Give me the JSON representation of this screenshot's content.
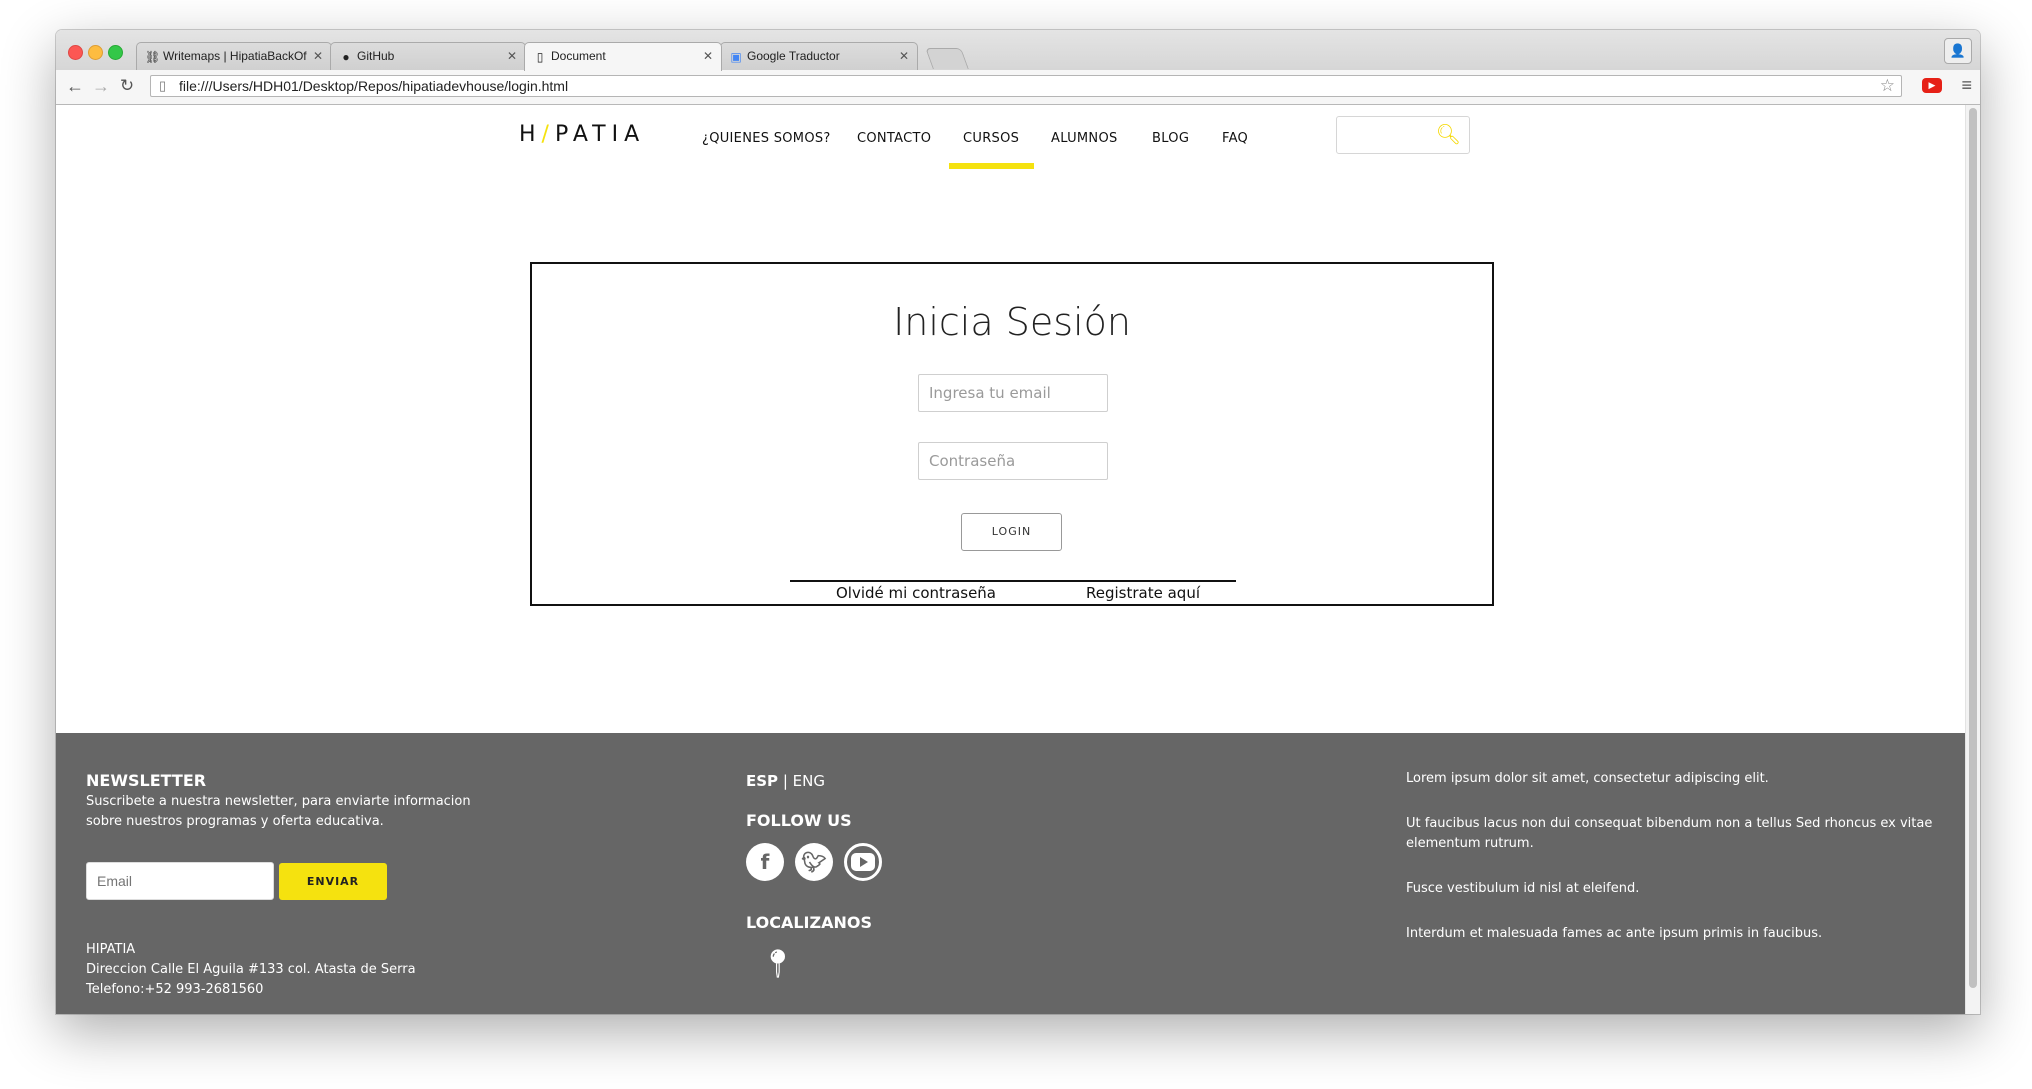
{
  "browser": {
    "tabs": [
      {
        "title": "Writemaps | HipatiaBackOf",
        "icon": "sitemap-icon"
      },
      {
        "title": "GitHub",
        "icon": "github-icon"
      },
      {
        "title": "Document",
        "icon": "document-icon"
      },
      {
        "title": "Google Traductor",
        "icon": "translate-icon"
      }
    ],
    "url": "file:///Users/HDH01/Desktop/Repos/hipatiadevhouse/login.html"
  },
  "site": {
    "logo": "H/PATIA",
    "nav": [
      "¿QUIENES SOMOS?",
      "CONTACTO",
      "CURSOS",
      "ALUMNOS",
      "BLOG",
      "FAQ"
    ],
    "active_nav": "CURSOS",
    "accent_color": "#f5e20f"
  },
  "login": {
    "title": "Inicia Sesión",
    "email_placeholder": "Ingresa tu email",
    "password_placeholder": "Contraseña",
    "button": "LOGIN",
    "forgot_link": "Olvidé mi contraseña",
    "register_link": "Registrate aquí"
  },
  "footer": {
    "newsletter_title": "NEWSLETTER",
    "newsletter_text_1": "Suscribete a nuestra newsletter, para enviarte informacion",
    "newsletter_text_2": "sobre nuestros programas y oferta educativa.",
    "email_placeholder": "Email",
    "send_button": "ENVIAR",
    "company": "HIPATIA",
    "address": "Direccion Calle El Aguila #133 col. Atasta de Serra",
    "phone": "Telefono:+52 993-2681560",
    "lang_esp": "ESP",
    "lang_sep": "|",
    "lang_eng": "ENG",
    "follow_title": "FOLLOW US",
    "locate_title": "LOCALIZANOS",
    "lorem_1": "Lorem ipsum dolor sit amet, consectetur adipiscing elit.",
    "lorem_2a": "Ut faucibus lacus non dui consequat bibendum non a tellus Sed rhoncus ex vitae",
    "lorem_2b": "elementum rutrum.",
    "lorem_3": "Fusce vestibulum id nisl at eleifend.",
    "lorem_4": "Interdum et malesuada fames ac ante ipsum primis in faucibus.",
    "background_color": "#666666"
  }
}
